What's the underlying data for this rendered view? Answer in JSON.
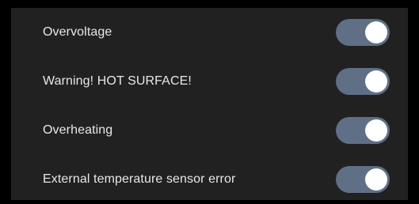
{
  "settings": {
    "items": [
      {
        "label": "Overvoltage",
        "enabled": true
      },
      {
        "label": "Warning! HOT SURFACE!",
        "enabled": true
      },
      {
        "label": "Overheating",
        "enabled": true
      },
      {
        "label": "External temperature sensor error",
        "enabled": true
      }
    ]
  },
  "colors": {
    "background": "#000000",
    "panel": "#212121",
    "text": "#e8e8e8",
    "toggle_track_on": "#5f6f86",
    "toggle_knob": "#ffffff"
  }
}
